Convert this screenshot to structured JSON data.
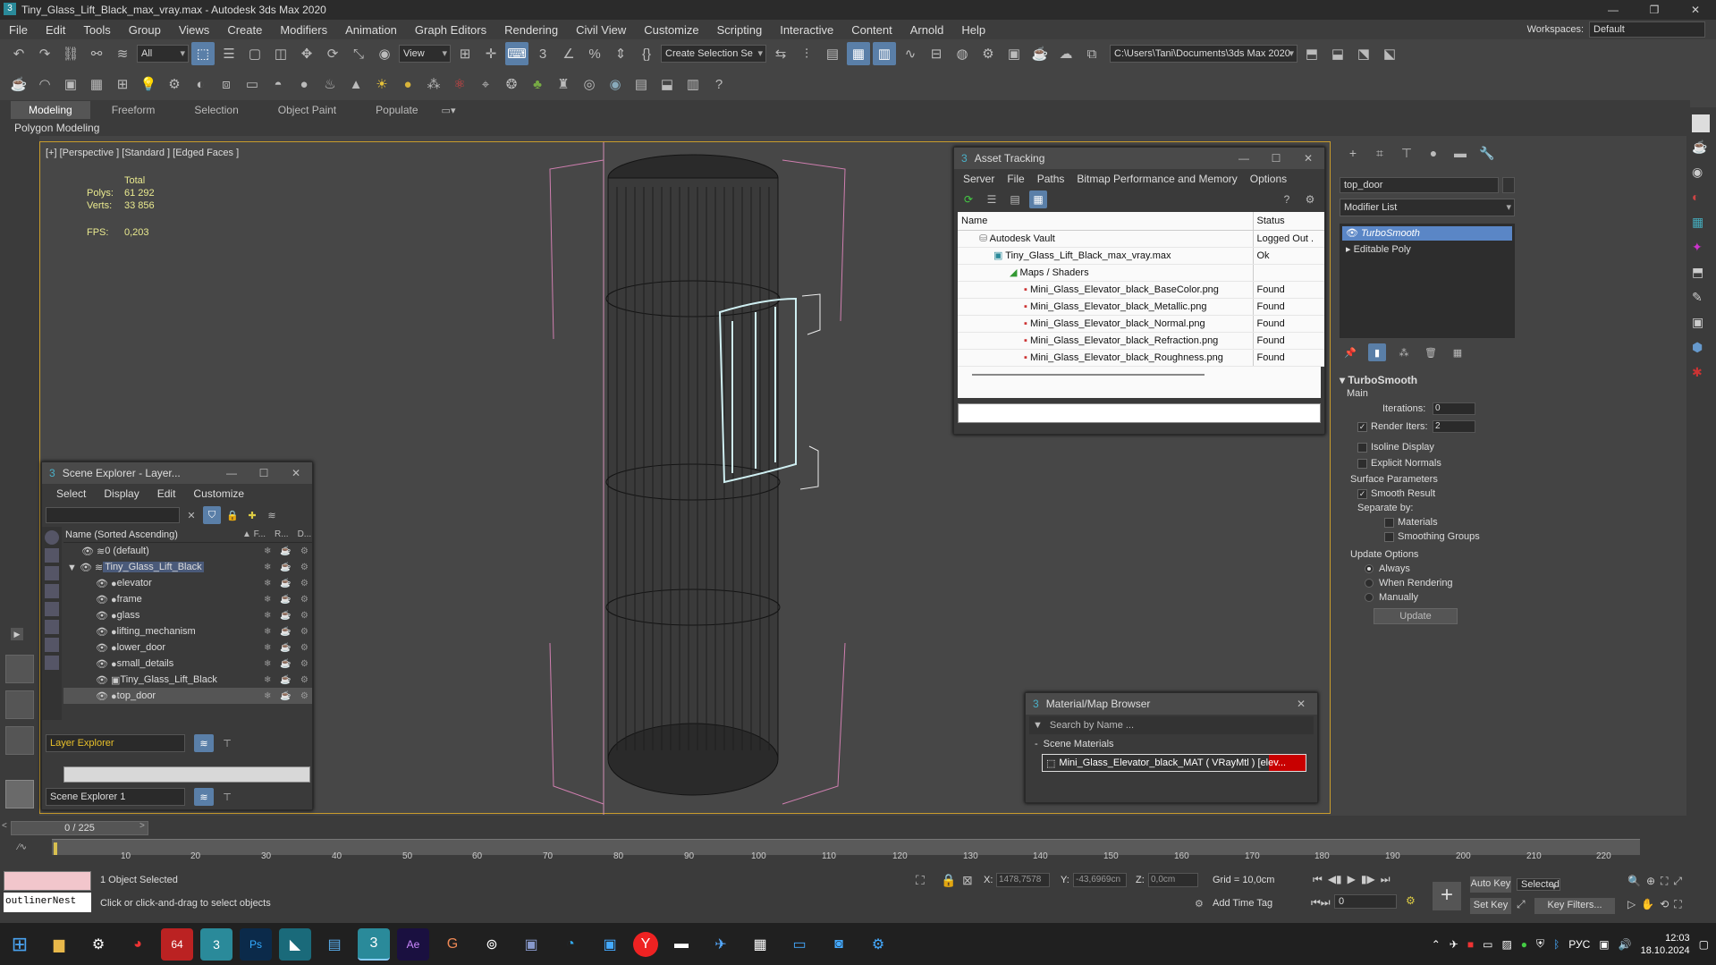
{
  "window": {
    "title": "Tiny_Glass_Lift_Black_max_vray.max - Autodesk 3ds Max 2020",
    "min": "—",
    "max": "❐",
    "close": "✕"
  },
  "menu": [
    "File",
    "Edit",
    "Tools",
    "Group",
    "Views",
    "Create",
    "Modifiers",
    "Animation",
    "Graph Editors",
    "Rendering",
    "Civil View",
    "Customize",
    "Scripting",
    "Interactive",
    "Content",
    "Arnold",
    "Help"
  ],
  "workspace": {
    "label": "Workspaces:",
    "value": "Default"
  },
  "toolbar": {
    "filter": "All",
    "view": "View",
    "selection_set": "Create Selection Se",
    "path": "C:\\Users\\Tani\\Documents\\3ds Max 2020"
  },
  "ribbon": {
    "tabs": [
      "Modeling",
      "Freeform",
      "Selection",
      "Object Paint",
      "Populate"
    ],
    "subtitle": "Polygon Modeling"
  },
  "viewport": {
    "label": "[+] [Perspective ] [Standard ] [Edged Faces ]",
    "stats_header": "Total",
    "polys_label": "Polys:",
    "polys": "61 292",
    "verts_label": "Verts:",
    "verts": "33 856",
    "fps_label": "FPS:",
    "fps": "0,203"
  },
  "asset_tracking": {
    "title": "Asset Tracking",
    "menu": [
      "Server",
      "File",
      "Paths",
      "Bitmap Performance and Memory",
      "Options"
    ],
    "col_name": "Name",
    "col_status": "Status",
    "rows": [
      {
        "name": "Autodesk Vault",
        "status": "Logged Out ."
      },
      {
        "name": "Tiny_Glass_Lift_Black_max_vray.max",
        "status": "Ok"
      },
      {
        "name": "Maps / Shaders",
        "status": ""
      },
      {
        "name": "Mini_Glass_Elevator_black_BaseColor.png",
        "status": "Found"
      },
      {
        "name": "Mini_Glass_Elevator_black_Metallic.png",
        "status": "Found"
      },
      {
        "name": "Mini_Glass_Elevator_black_Normal.png",
        "status": "Found"
      },
      {
        "name": "Mini_Glass_Elevator_black_Refraction.png",
        "status": "Found"
      },
      {
        "name": "Mini_Glass_Elevator_black_Roughness.png",
        "status": "Found"
      }
    ]
  },
  "scene_explorer": {
    "title": "Scene Explorer - Layer...",
    "menu": [
      "Select",
      "Display",
      "Edit",
      "Customize"
    ],
    "col_name": "Name (Sorted Ascending)",
    "col_f": "▲ F...",
    "col_r": "R...",
    "col_d": "D...",
    "items": [
      "0 (default)",
      "Tiny_Glass_Lift_Black",
      "elevator",
      "frame",
      "glass",
      "lifting_mechanism",
      "lower_door",
      "small_details",
      "Tiny_Glass_Lift_Black",
      "top_door"
    ],
    "layer_explorer": "Layer Explorer",
    "footer": "Scene Explorer 1"
  },
  "material_browser": {
    "title": "Material/Map Browser",
    "search": "Search by Name ...",
    "section": "Scene Materials",
    "material": "Mini_Glass_Elevator_black_MAT ( VRayMtl ) [elev..."
  },
  "modify_panel": {
    "object_name": "top_door",
    "modifier_list": "Modifier List",
    "stack": [
      "TurboSmooth",
      "Editable Poly"
    ],
    "rollout": "TurboSmooth",
    "main": "Main",
    "iterations_label": "Iterations:",
    "iterations": "0",
    "render_iters_label": "Render Iters:",
    "render_iters": "2",
    "isoline": "Isoline Display",
    "explicit_normals": "Explicit Normals",
    "surface_params": "Surface Parameters",
    "smooth_result": "Smooth Result",
    "separate_by": "Separate by:",
    "materials": "Materials",
    "smoothing_groups": "Smoothing Groups",
    "update_options": "Update Options",
    "always": "Always",
    "when_rendering": "When Rendering",
    "manually": "Manually",
    "update_button": "Update"
  },
  "timeline": {
    "frame": "0 / 225",
    "ticks": [
      "10",
      "20",
      "30",
      "40",
      "50",
      "60",
      "70",
      "80",
      "90",
      "100",
      "110",
      "120",
      "130",
      "140",
      "150",
      "160",
      "170",
      "180",
      "190",
      "200",
      "210",
      "220"
    ]
  },
  "status": {
    "objects_selected": "1 Object Selected",
    "prompt": "Click or click-and-drag to select objects",
    "maxscript": "outlinerNest",
    "x_label": "X:",
    "x": "1478,7578",
    "y_label": "Y:",
    "y": "-43,6969cn",
    "z_label": "Z:",
    "z": "0,0cm",
    "grid": "Grid = 10,0cm",
    "add_time_tag": "Add Time Tag",
    "auto_key": "Auto Key",
    "selected": "Selected",
    "set_key": "Set Key",
    "key_filters": "Key Filters...",
    "frame_field": "0"
  },
  "taskbar": {
    "lang": "РУС",
    "time": "12:03",
    "date": "18.10.2024"
  }
}
